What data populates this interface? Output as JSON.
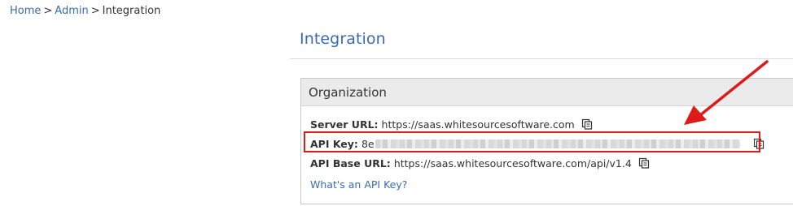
{
  "breadcrumb": {
    "items": [
      "Home",
      "Admin"
    ],
    "separator": ">",
    "current": "Integration"
  },
  "page": {
    "title": "Integration"
  },
  "organization": {
    "header": "Organization",
    "server_url": {
      "label": "Server URL:",
      "value": "https://saas.whitesourcesoftware.com"
    },
    "api_key": {
      "label": "API Key:",
      "value_visible_prefix": "8e"
    },
    "api_base_url": {
      "label": "API Base URL:",
      "value": "https://saas.whitesourcesoftware.com/api/v1.4"
    },
    "help_link": "What's an API Key?"
  },
  "colors": {
    "link_blue": "#3b6ab3",
    "highlight_red": "#dd1b1b",
    "panel_header_bg": "#ebebeb"
  },
  "icons": {
    "copy": "copy-icon"
  }
}
